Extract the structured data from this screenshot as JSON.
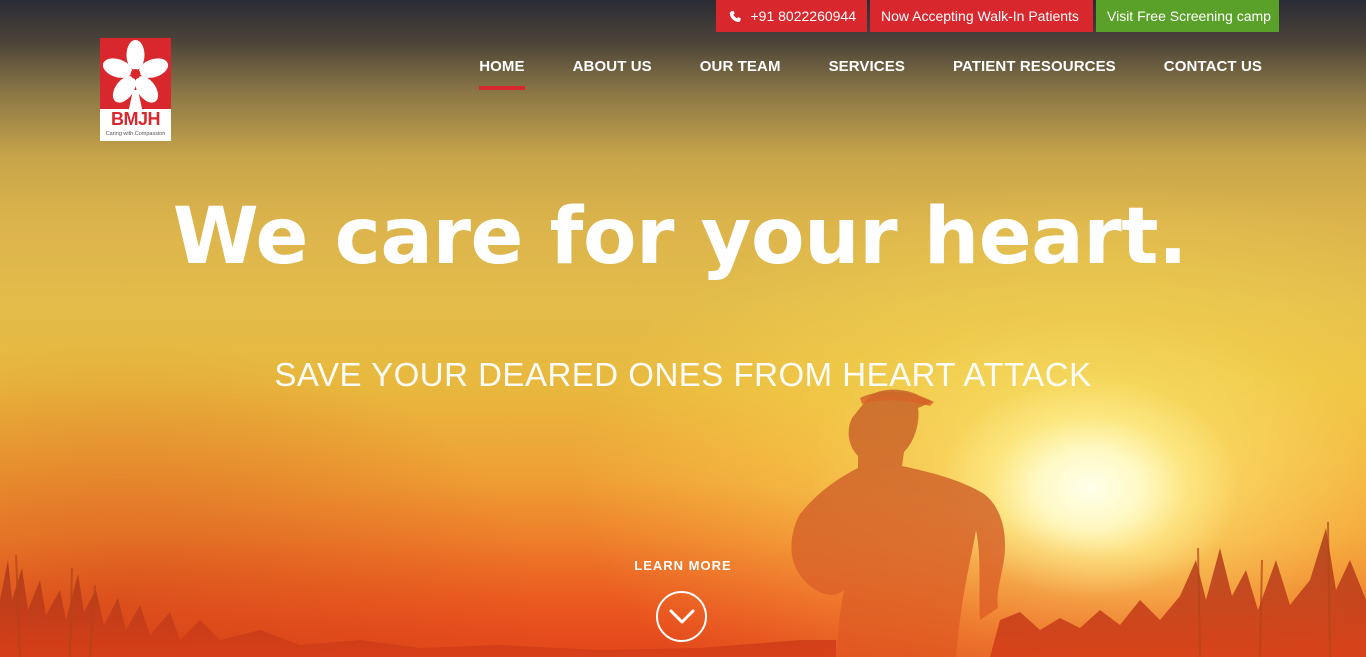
{
  "topbar": {
    "phone": "+91 8022260944",
    "walkin": "Now Accepting Walk-In Patients",
    "screening": "Visit Free Screening camp"
  },
  "logo": {
    "name": "BMJH",
    "tagline": "Caring with Compassion"
  },
  "nav": {
    "items": [
      {
        "label": "HOME",
        "active": true
      },
      {
        "label": "ABOUT US"
      },
      {
        "label": "OUR TEAM"
      },
      {
        "label": "SERVICES"
      },
      {
        "label": "PATIENT RESOURCES"
      },
      {
        "label": "CONTACT US"
      }
    ]
  },
  "hero": {
    "headline": "We care for your heart.",
    "subline": "SAVE YOUR DEARED ONES FROM HEART ATTACK",
    "learn_more": "LEARN MORE"
  },
  "icons": {
    "phone": "phone-icon",
    "scroll": "chevron-down-icon",
    "logo_flower": "flower-icon"
  },
  "colors": {
    "accent_red": "#d9272e",
    "accent_green": "#5aa12a"
  }
}
